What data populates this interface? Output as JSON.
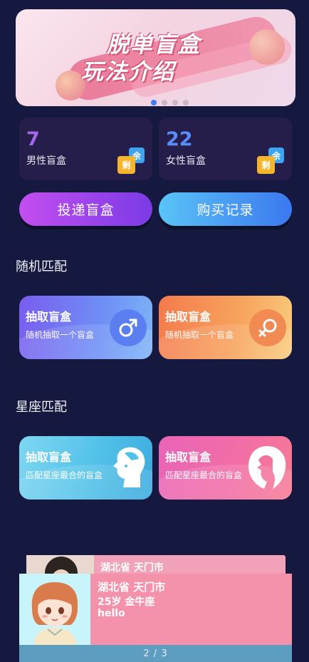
{
  "banner": {
    "line1": "脱单盲盒",
    "line2": "玩法介绍",
    "dots": 4,
    "active_dot": 0
  },
  "stats": {
    "male": {
      "count": "7",
      "label": "男性盲盒",
      "color": "#a566e8"
    },
    "female": {
      "count": "22",
      "label": "女性盲盒",
      "color": "#5a8cf7"
    },
    "tag_yu": "余",
    "tag_sheng": "剩"
  },
  "actions": {
    "deliver": "投递盲盒",
    "history": "购买记录"
  },
  "random_section": {
    "title": "随机匹配",
    "cards": [
      {
        "caption": "抽取盲盒",
        "subtitle": "随机抽取一个盲盒",
        "icon": "male-symbol-icon"
      },
      {
        "caption": "抽取盲盒",
        "subtitle": "随机抽取一个盲盒",
        "icon": "female-symbol-icon"
      }
    ]
  },
  "zodiac_section": {
    "title": "星座匹配",
    "cards": [
      {
        "caption": "抽取盲盒",
        "subtitle": "匹配星座最合的盲盒",
        "icon": "male-profile-icon"
      },
      {
        "caption": "抽取盲盒",
        "subtitle": "匹配星座最合的盲盒",
        "icon": "female-profile-icon"
      }
    ]
  },
  "profile_back": {
    "location": "湖北省 天门市"
  },
  "profile": {
    "location": "湖北省 天门市",
    "info": "25岁 金牛座",
    "bio": "hello",
    "pager": "2 / 3"
  }
}
